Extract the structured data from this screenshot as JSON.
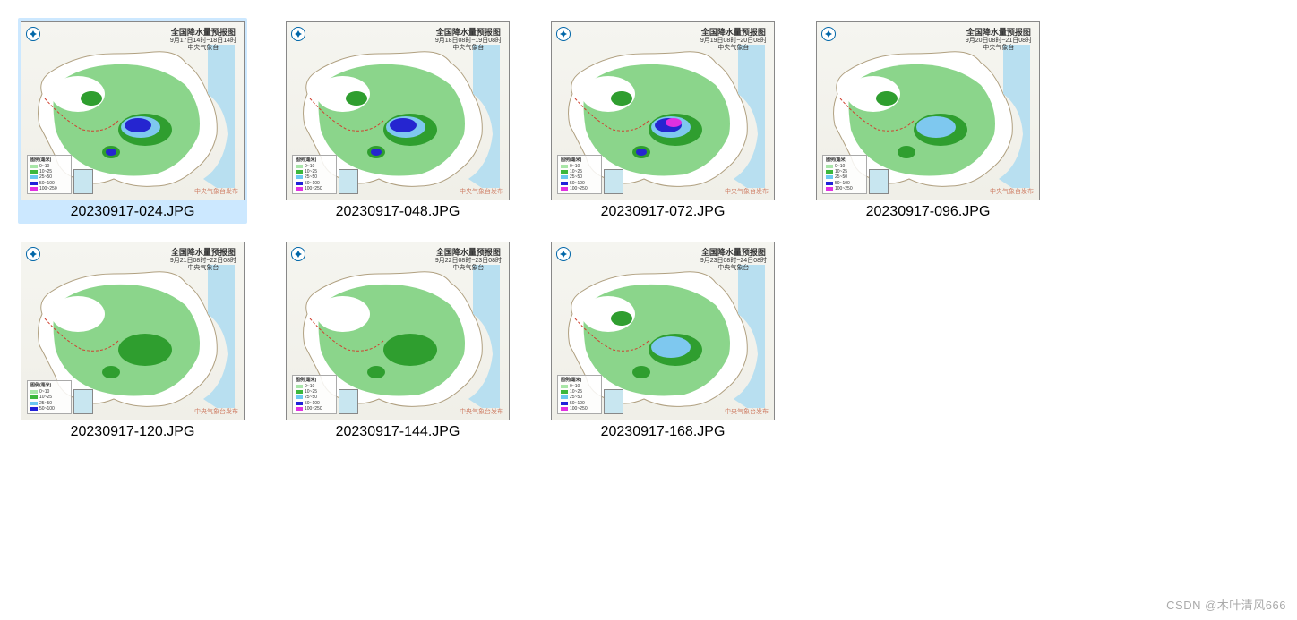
{
  "map_title": "全国降水量预报图",
  "map_source": "中央气象台",
  "legend_header": "图例(毫米)",
  "legend_items": [
    {
      "color": "#a8e6a8",
      "label": "0~10"
    },
    {
      "color": "#3cb83c",
      "label": "10~25"
    },
    {
      "color": "#6bc8f0",
      "label": "25~50"
    },
    {
      "color": "#2020d8",
      "label": "50~100"
    },
    {
      "color": "#e030e0",
      "label": "100~250"
    }
  ],
  "legend_items_alt": [
    {
      "color": "#a8e6a8",
      "label": "0~10"
    },
    {
      "color": "#3cb83c",
      "label": "10~25"
    },
    {
      "color": "#6bc8f0",
      "label": "25~50"
    },
    {
      "color": "#2020d8",
      "label": "50~100"
    }
  ],
  "items": [
    {
      "filename": "20230917-024.JPG",
      "subtitle": "9月17日14时~18日14时",
      "selected": true,
      "intensity": 4
    },
    {
      "filename": "20230917-048.JPG",
      "subtitle": "9月18日08时~19日08时",
      "selected": false,
      "intensity": 4
    },
    {
      "filename": "20230917-072.JPG",
      "subtitle": "9月19日08时~20日08时",
      "selected": false,
      "intensity": 5
    },
    {
      "filename": "20230917-096.JPG",
      "subtitle": "9月20日08时~21日08时",
      "selected": false,
      "intensity": 3
    },
    {
      "filename": "20230917-120.JPG",
      "subtitle": "9月21日08时~22日08时",
      "selected": false,
      "intensity": 2,
      "alt_legend": true
    },
    {
      "filename": "20230917-144.JPG",
      "subtitle": "9月22日08时~23日08时",
      "selected": false,
      "intensity": 2
    },
    {
      "filename": "20230917-168.JPG",
      "subtitle": "9月23日08时~24日08时",
      "selected": false,
      "intensity": 3
    }
  ],
  "watermark": "CSDN @木叶清风666"
}
